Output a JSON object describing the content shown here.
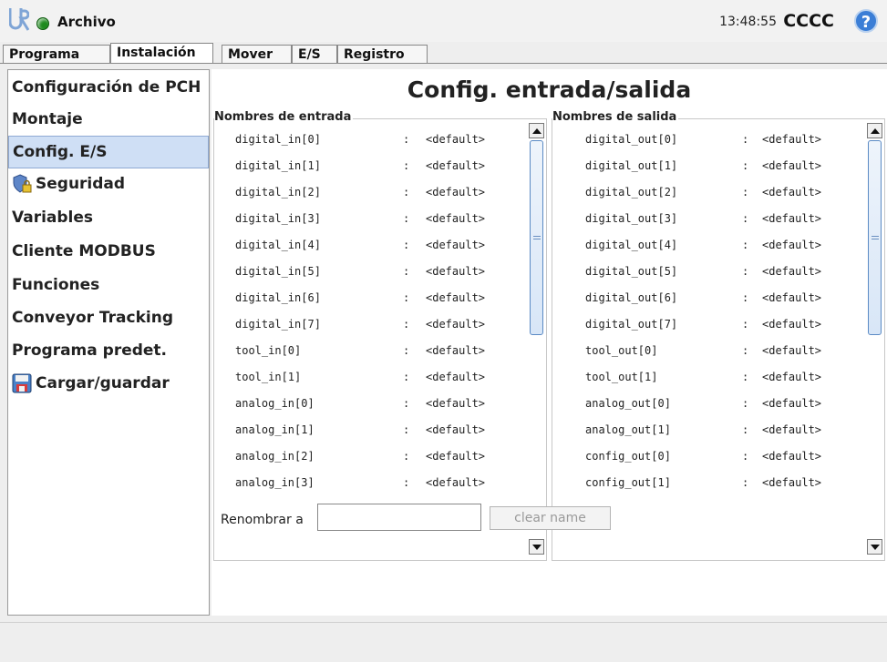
{
  "header": {
    "file_menu": "Archivo",
    "clock": "13:48:55",
    "robot_name": "CCCC",
    "help_glyph": "?"
  },
  "tabs": [
    {
      "label": "Programa",
      "active": false
    },
    {
      "label": "Instalación",
      "active": true
    },
    {
      "label": "Mover",
      "active": false
    },
    {
      "label": "E/S",
      "active": false
    },
    {
      "label": "Registro",
      "active": false
    }
  ],
  "sidebar": {
    "items": [
      {
        "label": "Configuración de PCH"
      },
      {
        "label": "Montaje"
      },
      {
        "label": "Config. E/S",
        "selected": true
      },
      {
        "label": "Seguridad",
        "icon": "shield-lock-icon"
      },
      {
        "label": "Variables"
      },
      {
        "label": "Cliente MODBUS"
      },
      {
        "label": "Funciones"
      },
      {
        "label": "Conveyor Tracking"
      },
      {
        "label": "Programa predet."
      },
      {
        "label": "Cargar/guardar",
        "icon": "floppy-disk-icon"
      }
    ]
  },
  "main": {
    "title": "Config. entrada/salida",
    "inputs": {
      "label": "Nombres de entrada",
      "separator": ":",
      "rows": [
        {
          "name": "digital_in[0]",
          "value": "<default>"
        },
        {
          "name": "digital_in[1]",
          "value": "<default>"
        },
        {
          "name": "digital_in[2]",
          "value": "<default>"
        },
        {
          "name": "digital_in[3]",
          "value": "<default>"
        },
        {
          "name": "digital_in[4]",
          "value": "<default>"
        },
        {
          "name": "digital_in[5]",
          "value": "<default>"
        },
        {
          "name": "digital_in[6]",
          "value": "<default>"
        },
        {
          "name": "digital_in[7]",
          "value": "<default>"
        },
        {
          "name": "tool_in[0]",
          "value": "<default>"
        },
        {
          "name": "tool_in[1]",
          "value": "<default>"
        },
        {
          "name": "analog_in[0]",
          "value": "<default>"
        },
        {
          "name": "analog_in[1]",
          "value": "<default>"
        },
        {
          "name": "analog_in[2]",
          "value": "<default>"
        },
        {
          "name": "analog_in[3]",
          "value": "<default>"
        }
      ]
    },
    "outputs": {
      "label": "Nombres de salida",
      "separator": ":",
      "rows": [
        {
          "name": "digital_out[0]",
          "value": "<default>"
        },
        {
          "name": "digital_out[1]",
          "value": "<default>"
        },
        {
          "name": "digital_out[2]",
          "value": "<default>"
        },
        {
          "name": "digital_out[3]",
          "value": "<default>"
        },
        {
          "name": "digital_out[4]",
          "value": "<default>"
        },
        {
          "name": "digital_out[5]",
          "value": "<default>"
        },
        {
          "name": "digital_out[6]",
          "value": "<default>"
        },
        {
          "name": "digital_out[7]",
          "value": "<default>"
        },
        {
          "name": "tool_out[0]",
          "value": "<default>"
        },
        {
          "name": "tool_out[1]",
          "value": "<default>"
        },
        {
          "name": "analog_out[0]",
          "value": "<default>"
        },
        {
          "name": "analog_out[1]",
          "value": "<default>"
        },
        {
          "name": "config_out[0]",
          "value": "<default>"
        },
        {
          "name": "config_out[1]",
          "value": "<default>"
        }
      ]
    },
    "rename": {
      "label": "Renombrar a",
      "value": "",
      "clear_label": "clear name"
    }
  },
  "colors": {
    "selected_bg": "#cfdff5",
    "status_dot": "#1e8a1e",
    "help_blue": "#3b7ed6"
  }
}
